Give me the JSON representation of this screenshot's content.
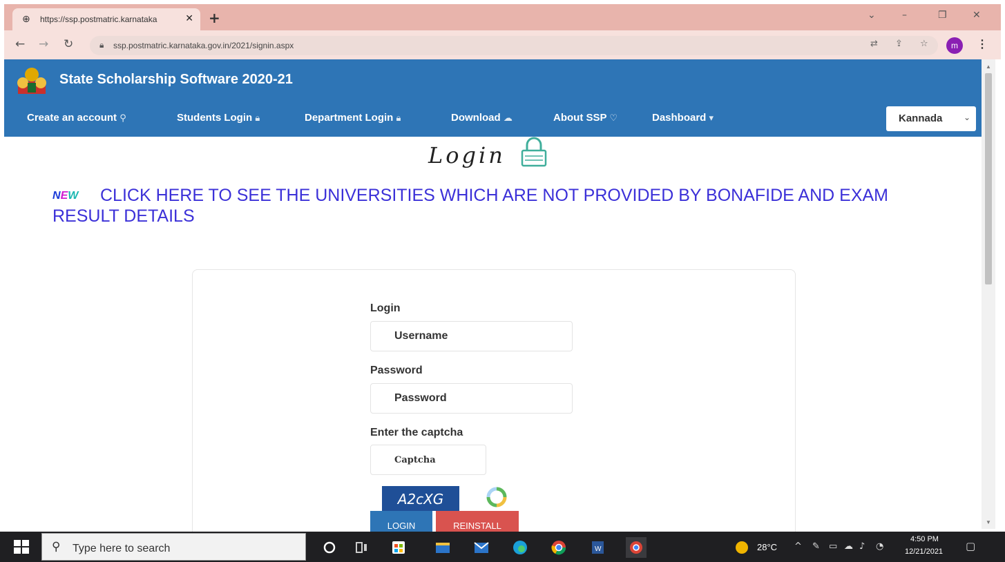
{
  "browser": {
    "tab_title": "https://ssp.postmatric.karnataka",
    "tab_close": "✕",
    "new_tab": "+",
    "url": "ssp.postmatric.karnataka.gov.in/2021/signin.aspx",
    "profile_initial": "m"
  },
  "header": {
    "title": "State Scholarship Software 2020-21",
    "nav": [
      {
        "label": "Create an account",
        "icon": "user-icon"
      },
      {
        "label": "Students Login",
        "icon": "lock-icon"
      },
      {
        "label": "Department Login",
        "icon": "lock-icon"
      },
      {
        "label": "Download",
        "icon": "cloud-download-icon"
      },
      {
        "label": "About SSP",
        "icon": "bulb-icon"
      },
      {
        "label": "Dashboard",
        "icon": "caret-down-icon"
      }
    ],
    "language": "Kannada"
  },
  "main": {
    "heading": "Login",
    "new_badge": {
      "n": "N",
      "e": "E",
      "w": "W"
    },
    "notice": "CLICK HERE TO SEE THE UNIVERSITIES WHICH ARE NOT PROVIDED BY BONAFIDE AND EXAM RESULT DETAILS",
    "form": {
      "login_label": "Login",
      "username_placeholder": "Username",
      "password_label": "Password",
      "password_placeholder": "Password",
      "captcha_label": "Enter the captcha",
      "captcha_placeholder": "Captcha",
      "captcha_text": "A2cXG",
      "login_button": "LOGIN",
      "reinstall_button": "REINSTALL"
    }
  },
  "taskbar": {
    "search_placeholder": "Type here to search",
    "temperature": "28°C",
    "time": "4:50 PM",
    "date": "12/21/2021"
  },
  "colors": {
    "header_bg": "#2e75b6",
    "browser_frame": "#e8b4ac",
    "notice_link": "#3b30d8",
    "reinstall": "#d9534f"
  }
}
